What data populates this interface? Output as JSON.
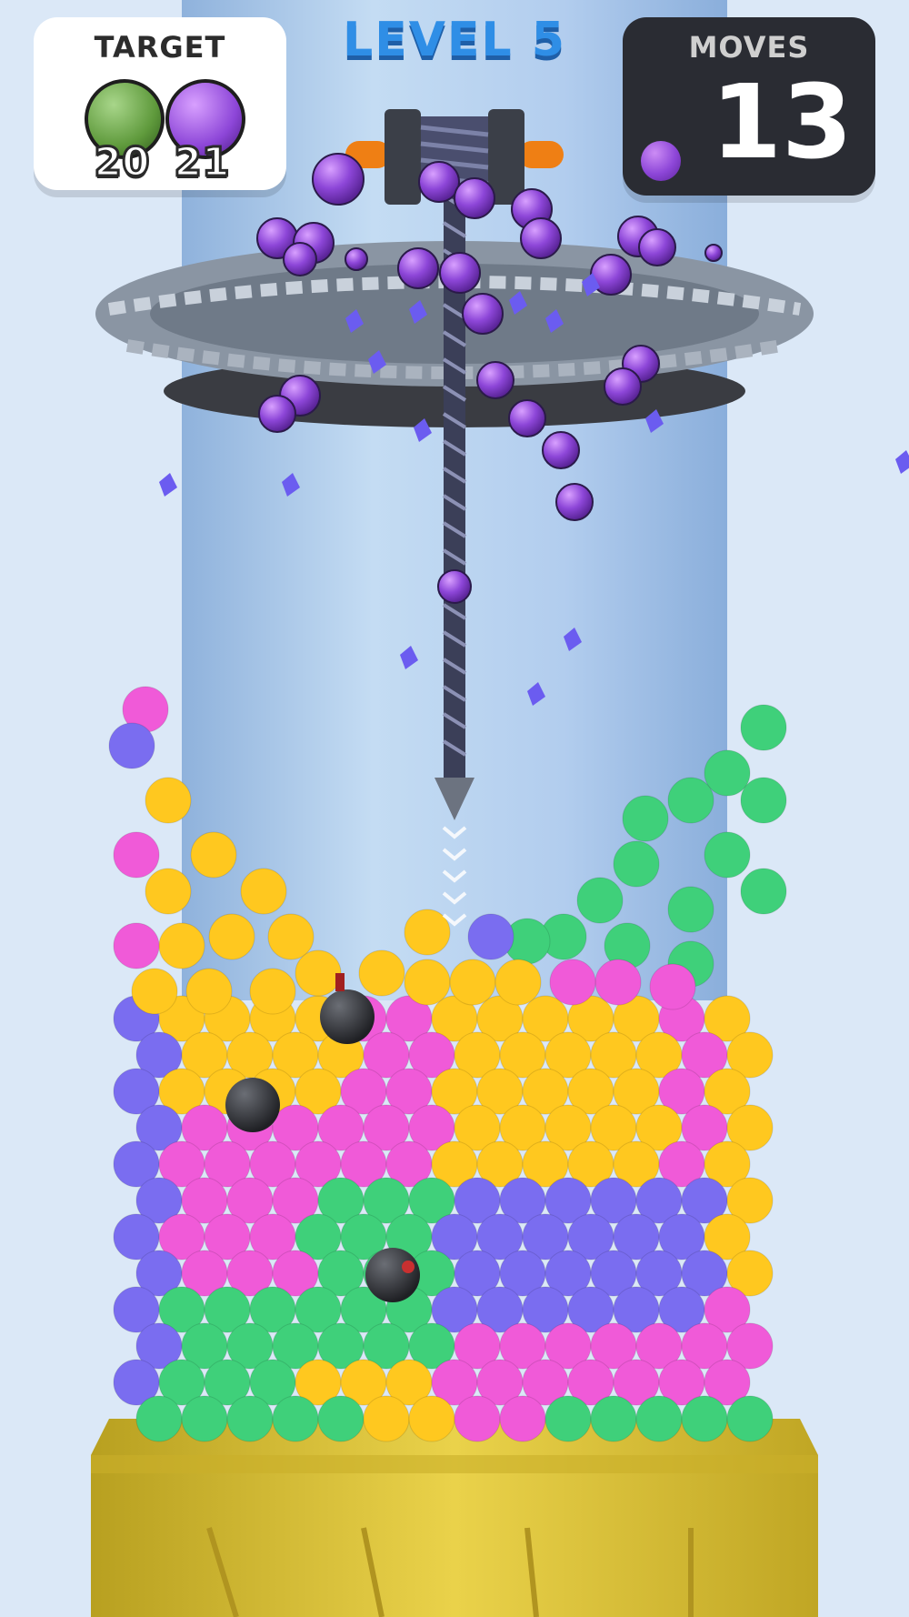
{
  "level": {
    "title": "LEVEL 5"
  },
  "target": {
    "title": "TARGET",
    "items": [
      {
        "color_name": "green",
        "color": "#5f9a3c",
        "count": "20"
      },
      {
        "color_name": "purple",
        "color": "#8d46d8",
        "count": "21"
      }
    ]
  },
  "moves": {
    "title": "MOVES",
    "value": "13",
    "ball_color": "#8d46d8"
  },
  "palette": {
    "pink": "#f05ad8",
    "purple": "#7a6df0",
    "green": "#3fd07a",
    "yellow": "#ffc81f",
    "bomb": "#2f3136",
    "tube": "#a9c6ea",
    "pedestal": "#d9c238"
  }
}
